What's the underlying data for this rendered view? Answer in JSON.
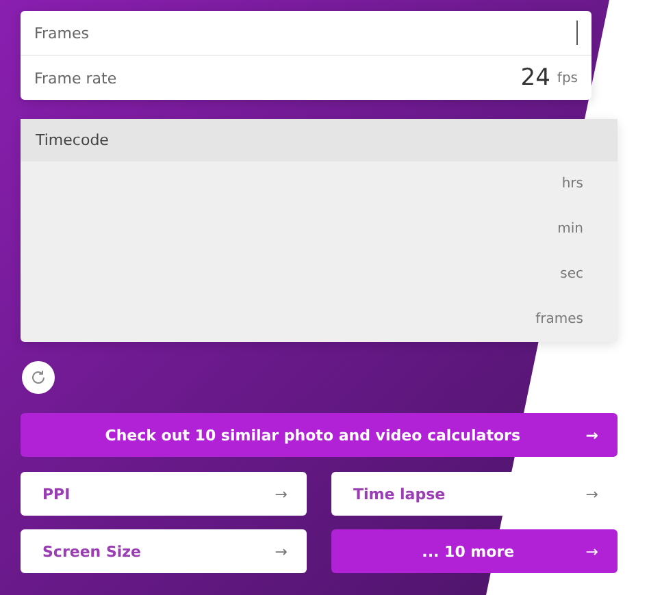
{
  "inputs": [
    {
      "label": "Frames",
      "focused": true
    },
    {
      "label": "Frame rate",
      "value": "24",
      "unit": "fps",
      "focused": false
    }
  ],
  "timecode": {
    "title": "Timecode",
    "units": [
      "hrs",
      "min",
      "sec",
      "frames"
    ]
  },
  "cta": {
    "label": "Check out 10 similar photo and video calculators",
    "arrow": "→"
  },
  "links": [
    {
      "label": "PPI",
      "arrow": "→",
      "kind": "plain"
    },
    {
      "label": "Time lapse",
      "arrow": "→",
      "kind": "plain"
    },
    {
      "label": "Screen Size",
      "arrow": "→",
      "kind": "plain"
    },
    {
      "label": "... 10 more",
      "arrow": "→",
      "kind": "more"
    }
  ]
}
